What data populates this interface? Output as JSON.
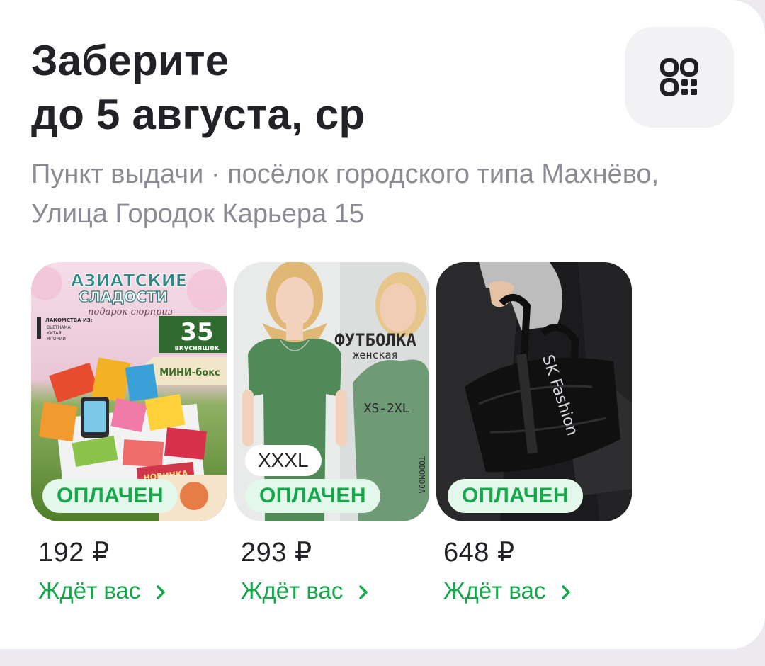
{
  "header": {
    "title_line1": "Заберите",
    "title_line2": "до 5 августа, ср",
    "qr_icon": "qr-code-icon"
  },
  "pickup": {
    "line1": "Пункт выдачи · посёлок городского типа Махнёво,",
    "line2": "Улица Городок Карьера 15"
  },
  "products": [
    {
      "image": "asian-sweets-box-image",
      "image_text": {
        "title": "АЗИАТСКИЕ",
        "subtitle": "СЛАДОСТИ",
        "script": "подарок-сюрприз",
        "list_head": "ЛАКОМСТВА ИЗ:",
        "list": [
          "ВЬЕТНАМА",
          "КИТАЯ",
          "ЯПОНИИ"
        ],
        "count": "35",
        "count_label": "вкусняшек",
        "tag": "МИНИ-бокс",
        "corner": "НОВИНКА"
      },
      "badge": "ОПЛАЧЕН",
      "size": "",
      "price": "192 ₽",
      "status": "Ждёт вас"
    },
    {
      "image": "womens-tshirt-image",
      "image_text": {
        "title": "ФУТБОЛКА",
        "subtitle": "женская",
        "sizes": "XS-2XL",
        "brand": "TODOMODA"
      },
      "badge": "ОПЛАЧЕН",
      "size": "XXXL",
      "price": "293 ₽",
      "status": "Ждёт вас"
    },
    {
      "image": "sports-bag-image",
      "image_text": {
        "brand": "SK Fashion"
      },
      "badge": "ОПЛАЧЕН",
      "size": "",
      "price": "648 ₽",
      "status": "Ждёт вас"
    }
  ],
  "colors": {
    "accent_green": "#14a84a",
    "badge_bg": "#e3f7ea",
    "text_primary": "#222226",
    "text_secondary": "#8b8b93",
    "page_bg": "#ece9ef"
  }
}
